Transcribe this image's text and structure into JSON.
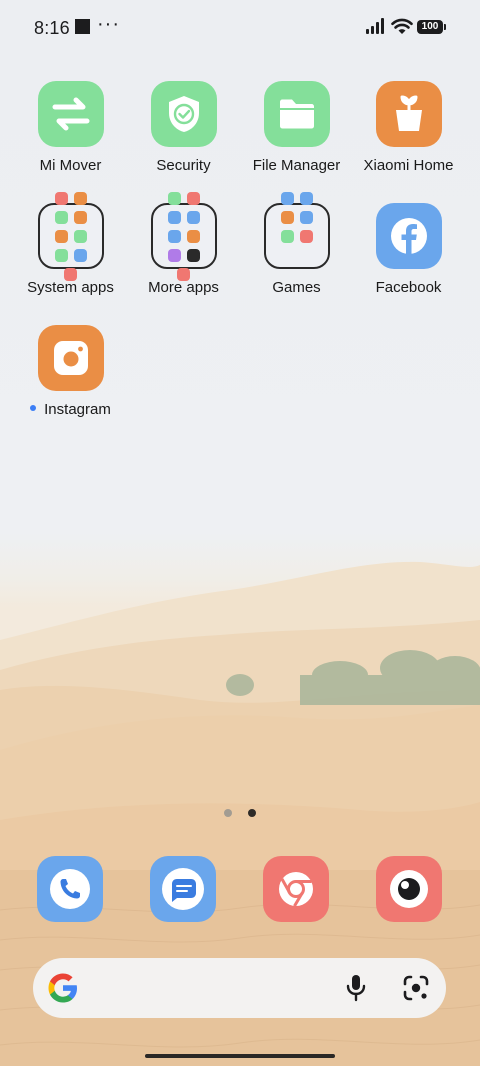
{
  "status_bar": {
    "time": "8:16",
    "overflow": "···",
    "battery": "100"
  },
  "apps": [
    {
      "id": "mi-mover",
      "label": "Mi Mover"
    },
    {
      "id": "security",
      "label": "Security"
    },
    {
      "id": "file-manager",
      "label": "File Manager"
    },
    {
      "id": "xiaomi-home",
      "label": "Xiaomi Home"
    },
    {
      "id": "system-apps",
      "label": "System apps"
    },
    {
      "id": "more-apps",
      "label": "More apps"
    },
    {
      "id": "games",
      "label": "Games"
    },
    {
      "id": "facebook",
      "label": "Facebook"
    },
    {
      "id": "instagram",
      "label": "Instagram"
    }
  ],
  "pager": {
    "pages": 2,
    "current": 2
  },
  "dock": [
    "phone-icon",
    "messages-icon",
    "chrome-icon",
    "camera-icon"
  ],
  "colors": {
    "green_icon": "#84df9a",
    "orange_icon": "#ea8e45",
    "blue_icon": "#6aa6ec",
    "red_icon": "#f07771",
    "new_dot": "#3c7ef5"
  }
}
